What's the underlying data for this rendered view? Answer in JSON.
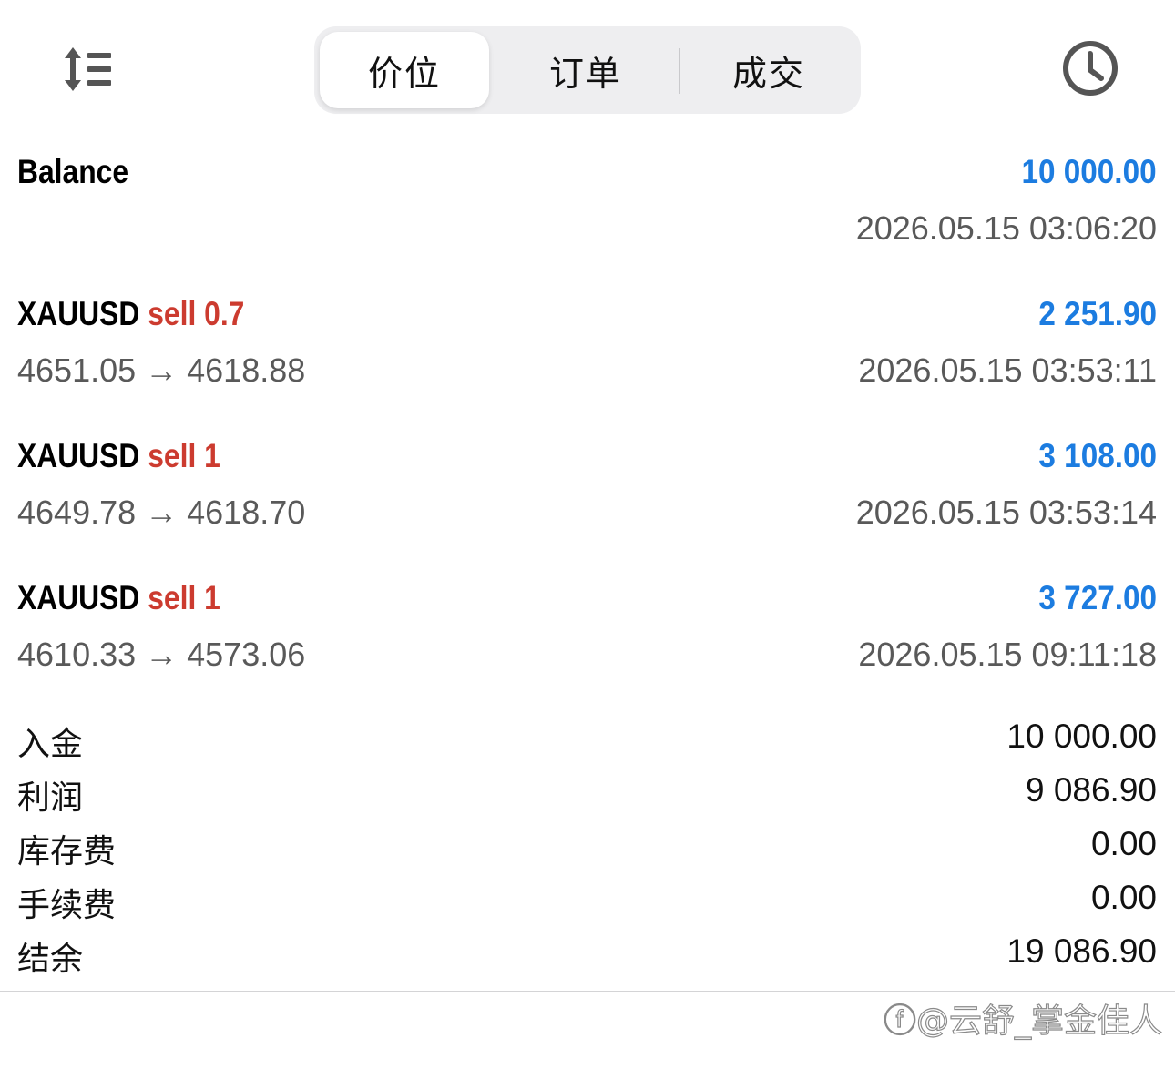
{
  "toolbar": {
    "sort_icon": "sort-lines-icon",
    "history_icon": "clock-icon",
    "tabs": [
      {
        "label": "价位",
        "active": true
      },
      {
        "label": "订单",
        "active": false
      },
      {
        "label": "成交",
        "active": false
      }
    ]
  },
  "balance_row": {
    "label": "Balance",
    "amount": "10 000.00",
    "time": "2026.05.15 03:06:20"
  },
  "deals": [
    {
      "symbol": "XAUUSD",
      "side": "sell",
      "volume": "0.7",
      "prices": "4651.05 → 4618.88",
      "profit": "2 251.90",
      "time": "2026.05.15 03:53:11"
    },
    {
      "symbol": "XAUUSD",
      "side": "sell",
      "volume": "1",
      "prices": "4649.78 → 4618.70",
      "profit": "3 108.00",
      "time": "2026.05.15 03:53:14"
    },
    {
      "symbol": "XAUUSD",
      "side": "sell",
      "volume": "1",
      "prices": "4610.33 → 4573.06",
      "profit": "3 727.00",
      "time": "2026.05.15 09:11:18"
    }
  ],
  "summary": [
    {
      "label": "入金",
      "value": "10 000.00"
    },
    {
      "label": "利润",
      "value": "9 086.90"
    },
    {
      "label": "库存费",
      "value": "0.00"
    },
    {
      "label": "手续费",
      "value": "0.00"
    },
    {
      "label": "结余",
      "value": "19 086.90"
    }
  ],
  "watermark": "ⓕ@云舒_掌金佳人",
  "colors": {
    "profit_blue": "#1c7ce0",
    "sell_red": "#cc3b2f",
    "secondary_text": "#595959",
    "segment_bg": "#eeeef0"
  }
}
